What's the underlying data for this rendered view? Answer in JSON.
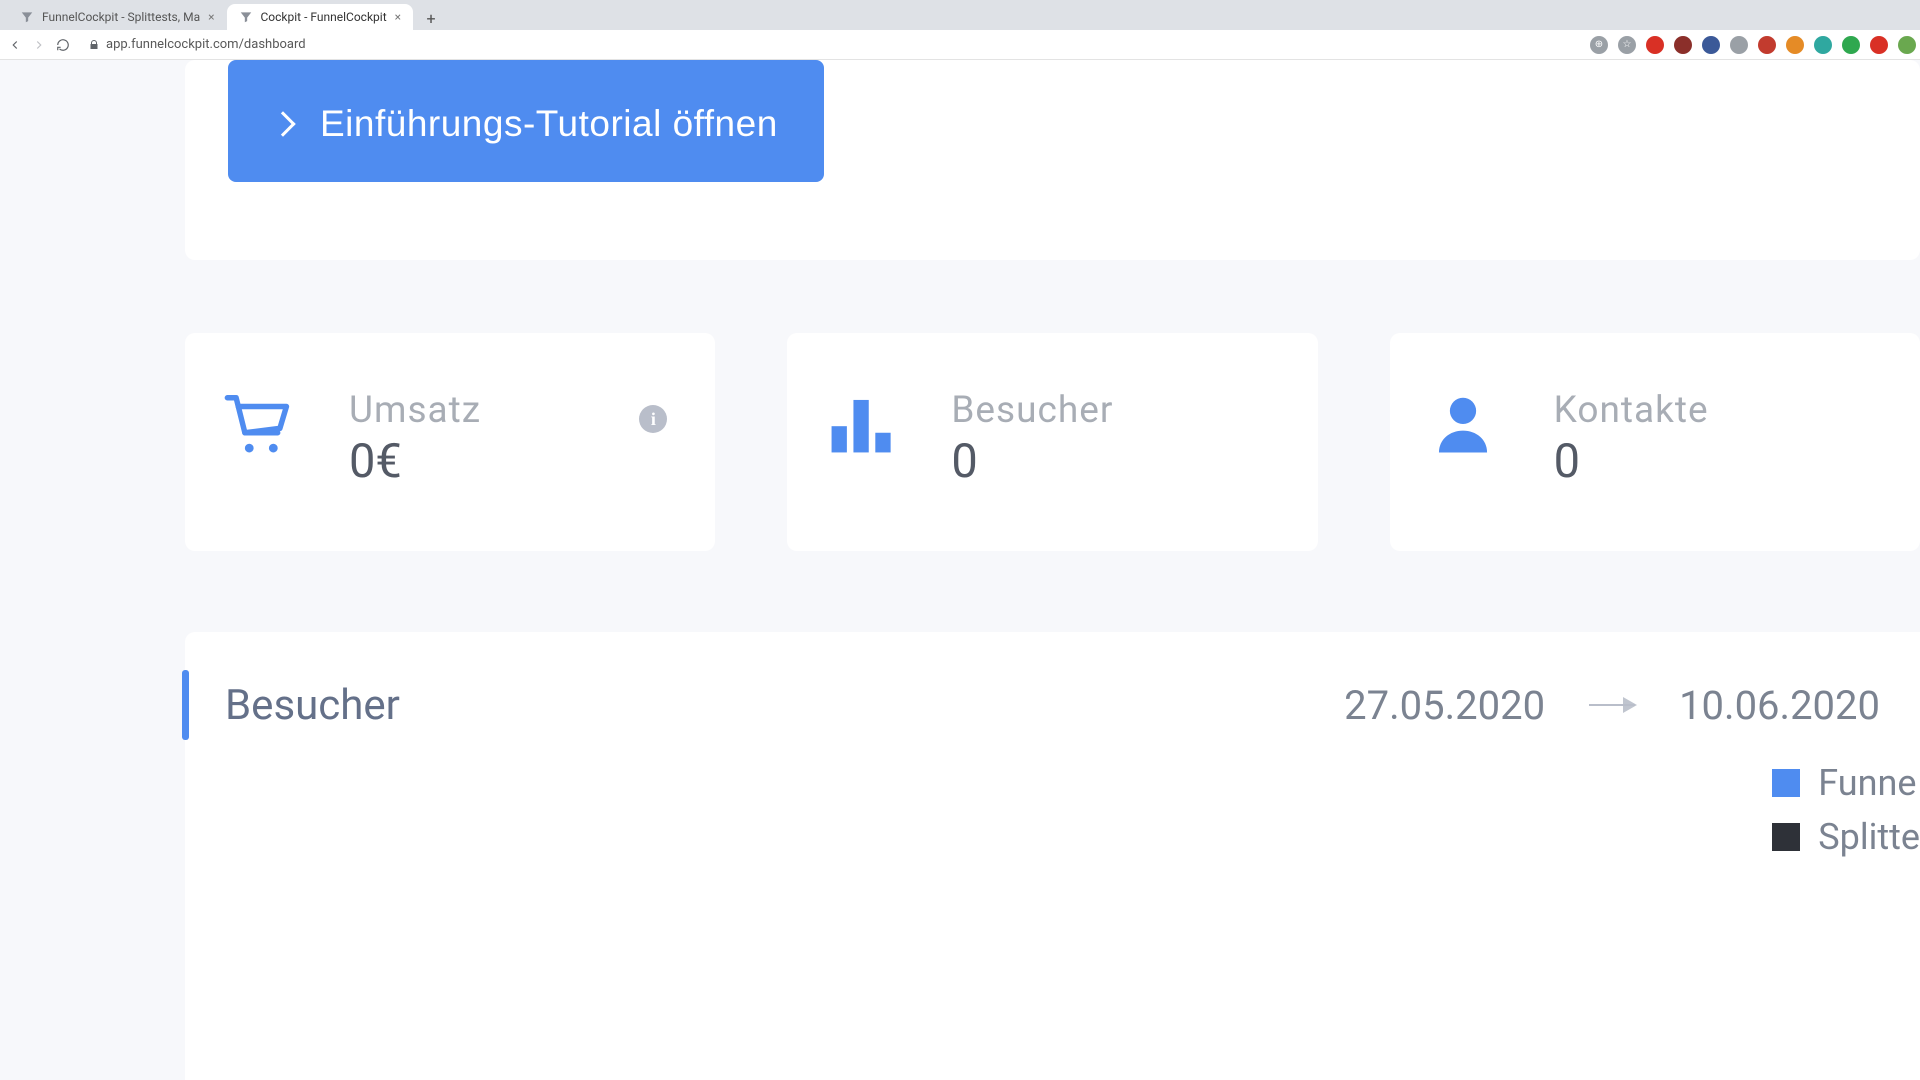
{
  "browser": {
    "tabs": [
      {
        "title": "FunnelCockpit - Splittests, Ma",
        "active": false
      },
      {
        "title": "Cockpit - FunnelCockpit",
        "active": true
      }
    ],
    "url_display": "app.funnelcockpit.com/dashboard",
    "toolbar_icons": [
      {
        "name": "site-info",
        "color": "#9aa0a6",
        "glyph": "⊕"
      },
      {
        "name": "star",
        "color": "#9aa0a6",
        "glyph": "☆"
      },
      {
        "name": "ext-red-1",
        "color": "#d93025",
        "glyph": ""
      },
      {
        "name": "ext-darkred",
        "color": "#8b2f2a",
        "glyph": ""
      },
      {
        "name": "ext-fb",
        "color": "#3b5998",
        "glyph": ""
      },
      {
        "name": "ext-gray-1",
        "color": "#9aa0a6",
        "glyph": ""
      },
      {
        "name": "ext-red-2",
        "color": "#c23b2e",
        "glyph": ""
      },
      {
        "name": "ext-orange",
        "color": "#e58b26",
        "glyph": ""
      },
      {
        "name": "ext-teal",
        "color": "#2fa8a0",
        "glyph": ""
      },
      {
        "name": "ext-green",
        "color": "#2fa84f",
        "glyph": ""
      },
      {
        "name": "ext-red-3",
        "color": "#d93025",
        "glyph": ""
      },
      {
        "name": "avatar",
        "color": "#6aa84f",
        "glyph": ""
      },
      {
        "name": "chrome-menu",
        "color": "#f0c14b",
        "glyph": ""
      }
    ]
  },
  "intro": {
    "tutorial_button": "Einführungs-Tutorial öffnen"
  },
  "stats": {
    "revenue": {
      "label": "Umsatz",
      "value": "0€"
    },
    "visitors": {
      "label": "Besucher",
      "value": "0"
    },
    "contacts": {
      "label": "Kontakte",
      "value": "0"
    }
  },
  "visitors_panel": {
    "title": "Besucher",
    "date_from": "27.05.2020",
    "date_to": "10.06.2020",
    "legend": {
      "series_a": "Funne",
      "series_b": "Splitte"
    }
  }
}
